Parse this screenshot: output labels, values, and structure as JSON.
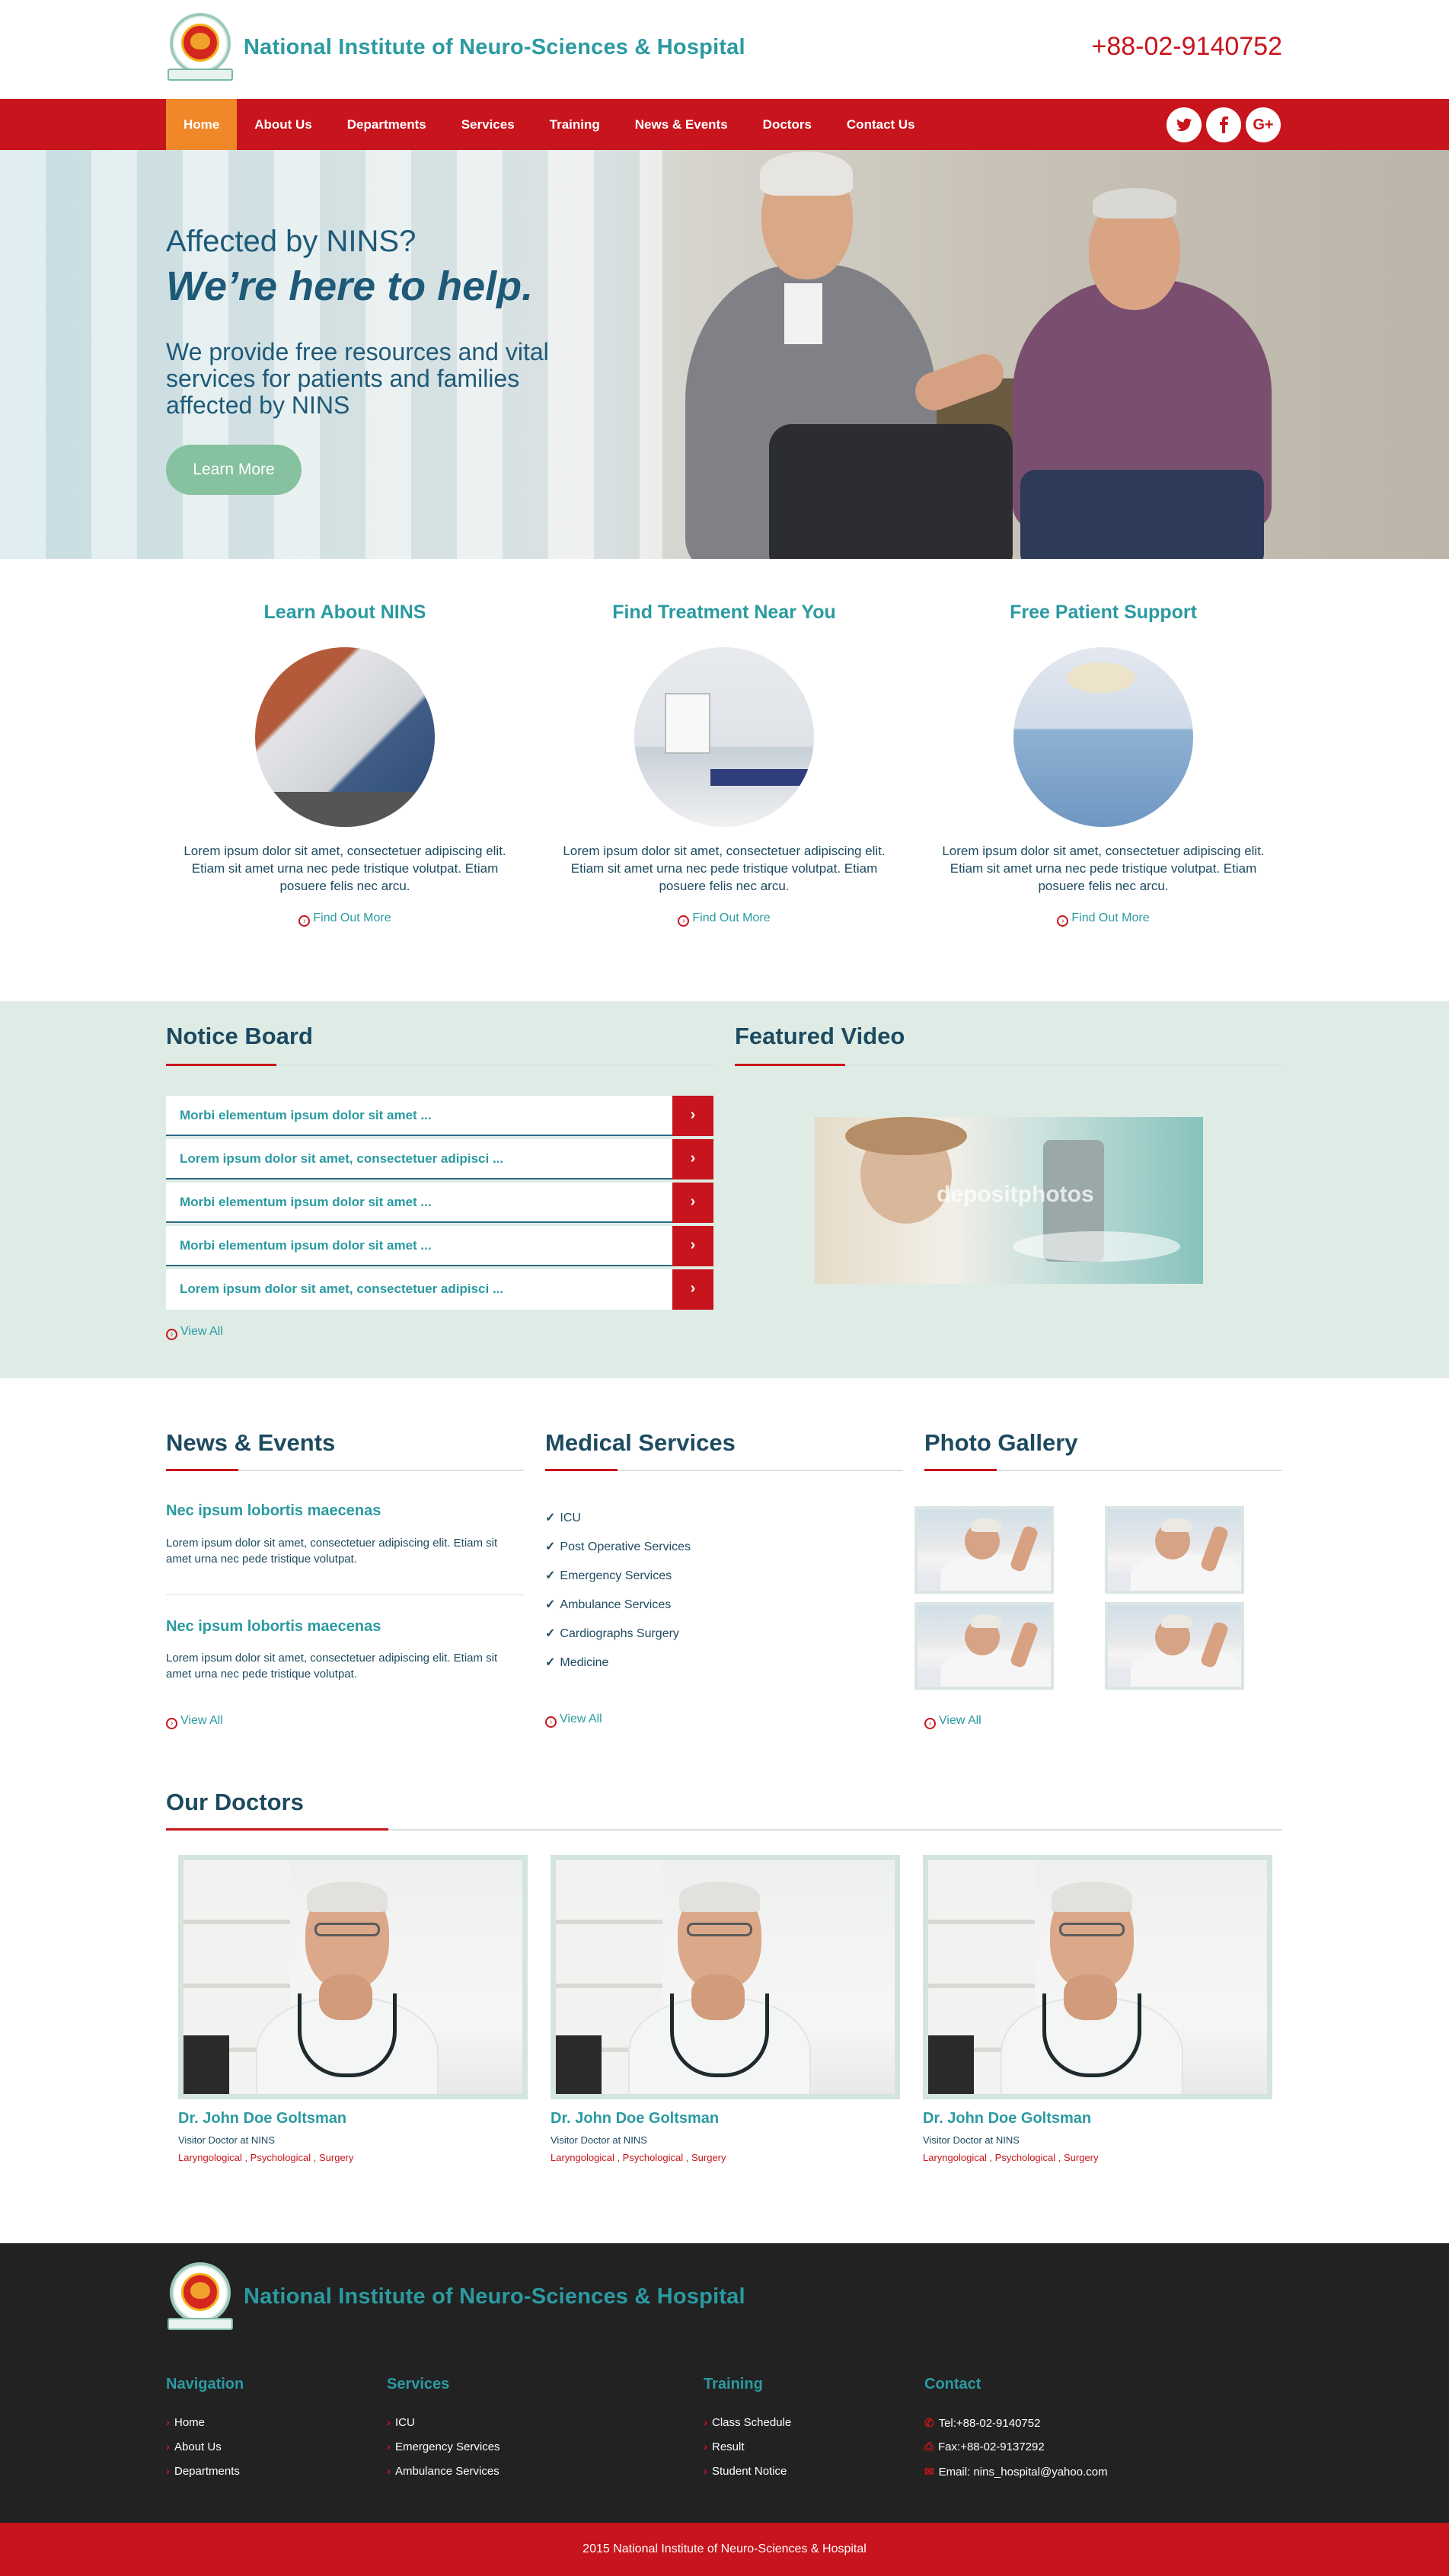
{
  "header": {
    "brand": "National Institute of Neuro-Sciences & Hospital",
    "phone": "+88-02-9140752"
  },
  "nav": {
    "items": [
      "Home",
      "About Us",
      "Departments",
      "Services",
      "Training",
      "News & Events",
      "Doctors",
      "Contact Us"
    ],
    "social": [
      "twitter-icon",
      "facebook-icon",
      "google-plus-icon"
    ]
  },
  "hero": {
    "line1": "Affected by NINS?",
    "line2": "We’re here to help.",
    "text": "We provide free resources and vital services for patients and families affected by NINS",
    "button": "Learn More"
  },
  "features": [
    {
      "title": "Learn About NINS",
      "text": "Lorem ipsum dolor sit amet, consectetuer adipiscing elit. Etiam sit amet urna nec pede tristique volutpat. Etiam posuere felis nec arcu.",
      "link": "Find Out More"
    },
    {
      "title": "Find Treatment Near You",
      "text": "Lorem ipsum dolor sit amet, consectetuer adipiscing elit. Etiam sit amet urna nec pede tristique volutpat. Etiam posuere felis nec arcu.",
      "link": "Find Out More"
    },
    {
      "title": "Free Patient Support",
      "text": "Lorem ipsum dolor sit amet, consectetuer adipiscing elit. Etiam sit amet urna nec pede tristique volutpat. Etiam posuere felis nec arcu.",
      "link": "Find Out More"
    }
  ],
  "notice": {
    "title": "Notice Board",
    "items": [
      "Morbi elementum ipsum dolor sit amet ...",
      "Lorem ipsum dolor sit amet, consectetuer adipisci ...",
      "Morbi elementum ipsum dolor sit amet ...",
      "Morbi elementum ipsum dolor sit amet ...",
      "Lorem ipsum dolor sit amet, consectetuer adipisci ..."
    ],
    "view_all": "View All"
  },
  "video": {
    "title": "Featured Video",
    "watermark": "depositphotos"
  },
  "news": {
    "title": "News & Events",
    "items": [
      {
        "title": "Nec ipsum lobortis maecenas",
        "text": "Lorem ipsum dolor sit amet, consectetuer adipiscing elit. Etiam sit amet urna nec pede tristique volutpat."
      },
      {
        "title": "Nec ipsum lobortis maecenas",
        "text": "Lorem ipsum dolor sit amet, consectetuer adipiscing elit. Etiam sit amet urna nec pede tristique volutpat."
      }
    ],
    "view_all": "View All"
  },
  "services": {
    "title": "Medical Services",
    "items": [
      "ICU",
      "Post Operative Services",
      "Emergency Services",
      "Ambulance Services",
      "Cardiographs Surgery",
      "Medicine"
    ],
    "view_all": "View All"
  },
  "gallery": {
    "title": "Photo Gallery",
    "view_all": "View All"
  },
  "doctors": {
    "title": "Our Doctors",
    "items": [
      {
        "name": "Dr. John Doe Goltsman",
        "role": "Visitor Doctor at NINS",
        "tags": "Laryngological , Psychological , Surgery"
      },
      {
        "name": "Dr. John Doe Goltsman",
        "role": "Visitor Doctor at NINS",
        "tags": "Laryngological , Psychological , Surgery"
      },
      {
        "name": "Dr. John Doe Goltsman",
        "role": "Visitor Doctor at NINS",
        "tags": "Laryngological , Psychological , Surgery"
      }
    ]
  },
  "footer": {
    "brand": "National Institute of Neuro-Sciences & Hospital",
    "navigation": {
      "title": "Navigation",
      "items": [
        "Home",
        "About Us",
        "Departments"
      ]
    },
    "services": {
      "title": "Services",
      "items": [
        "ICU",
        "Emergency Services",
        "Ambulance Services"
      ]
    },
    "training": {
      "title": "Training",
      "items": [
        "Class Schedule",
        "Result",
        "Student Notice"
      ]
    },
    "contact": {
      "title": "Contact",
      "items": [
        "Tel:+88-02-9140752",
        "Fax:+88-02-9137292",
        "Email: nins_hospital@yahoo.com"
      ]
    },
    "copyright": "2015 National Institute of Neuro-Sciences & Hospital"
  },
  "colors": {
    "primary": "#c8141c",
    "accent": "#2b9aa1",
    "active_nav": "#f0882a",
    "heading": "#1d4a5f",
    "notice_bg": "#dfece6",
    "footer_bg": "#222222"
  }
}
